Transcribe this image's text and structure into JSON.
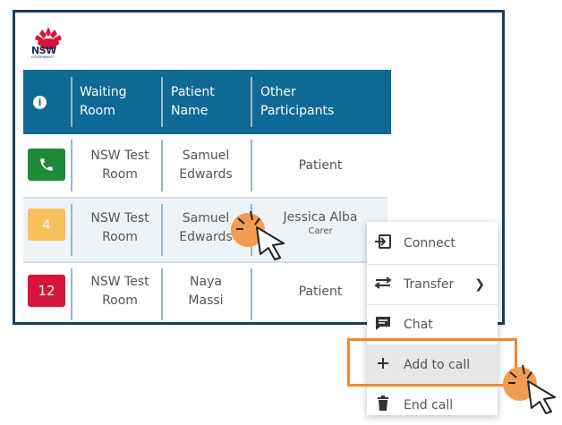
{
  "logo": {
    "text": "NSW",
    "subtext": "GOVERNMENT"
  },
  "table": {
    "headers": [
      {
        "label": "i",
        "icon": "info-icon"
      },
      {
        "label": "Waiting Room"
      },
      {
        "label": "Patient Name"
      },
      {
        "label": "Other Participants"
      }
    ],
    "rows": [
      {
        "badge": {
          "type": "phone-icon",
          "text": "",
          "color": "#1f8a3b"
        },
        "waiting_room": "NSW Test Room",
        "patient": "Samuel Edwards",
        "other": "Patient",
        "other_role": ""
      },
      {
        "badge": {
          "type": "number",
          "text": "4",
          "color": "#f7c15c"
        },
        "waiting_room": "NSW Test Room",
        "patient": "Samuel Edwards",
        "other": "Jessica Alba",
        "other_role": "Carer"
      },
      {
        "badge": {
          "type": "number",
          "text": "12",
          "color": "#d7153a"
        },
        "waiting_room": "NSW Test Room",
        "patient": "Naya Massi",
        "other": "Patient",
        "other_role": ""
      }
    ]
  },
  "context_menu": {
    "items": [
      {
        "label": "Connect",
        "icon": "connect-icon"
      },
      {
        "label": "Transfer",
        "icon": "transfer-icon",
        "has_submenu": true
      },
      {
        "label": "Chat",
        "icon": "chat-icon"
      },
      {
        "label": "Add to call",
        "icon": "plus-icon",
        "highlighted": true
      },
      {
        "label": "End call",
        "icon": "trash-icon"
      }
    ]
  },
  "colors": {
    "header": "#0e6a94",
    "frame": "#1b3f56",
    "highlight": "#f0892e",
    "click": "#f29c53"
  }
}
